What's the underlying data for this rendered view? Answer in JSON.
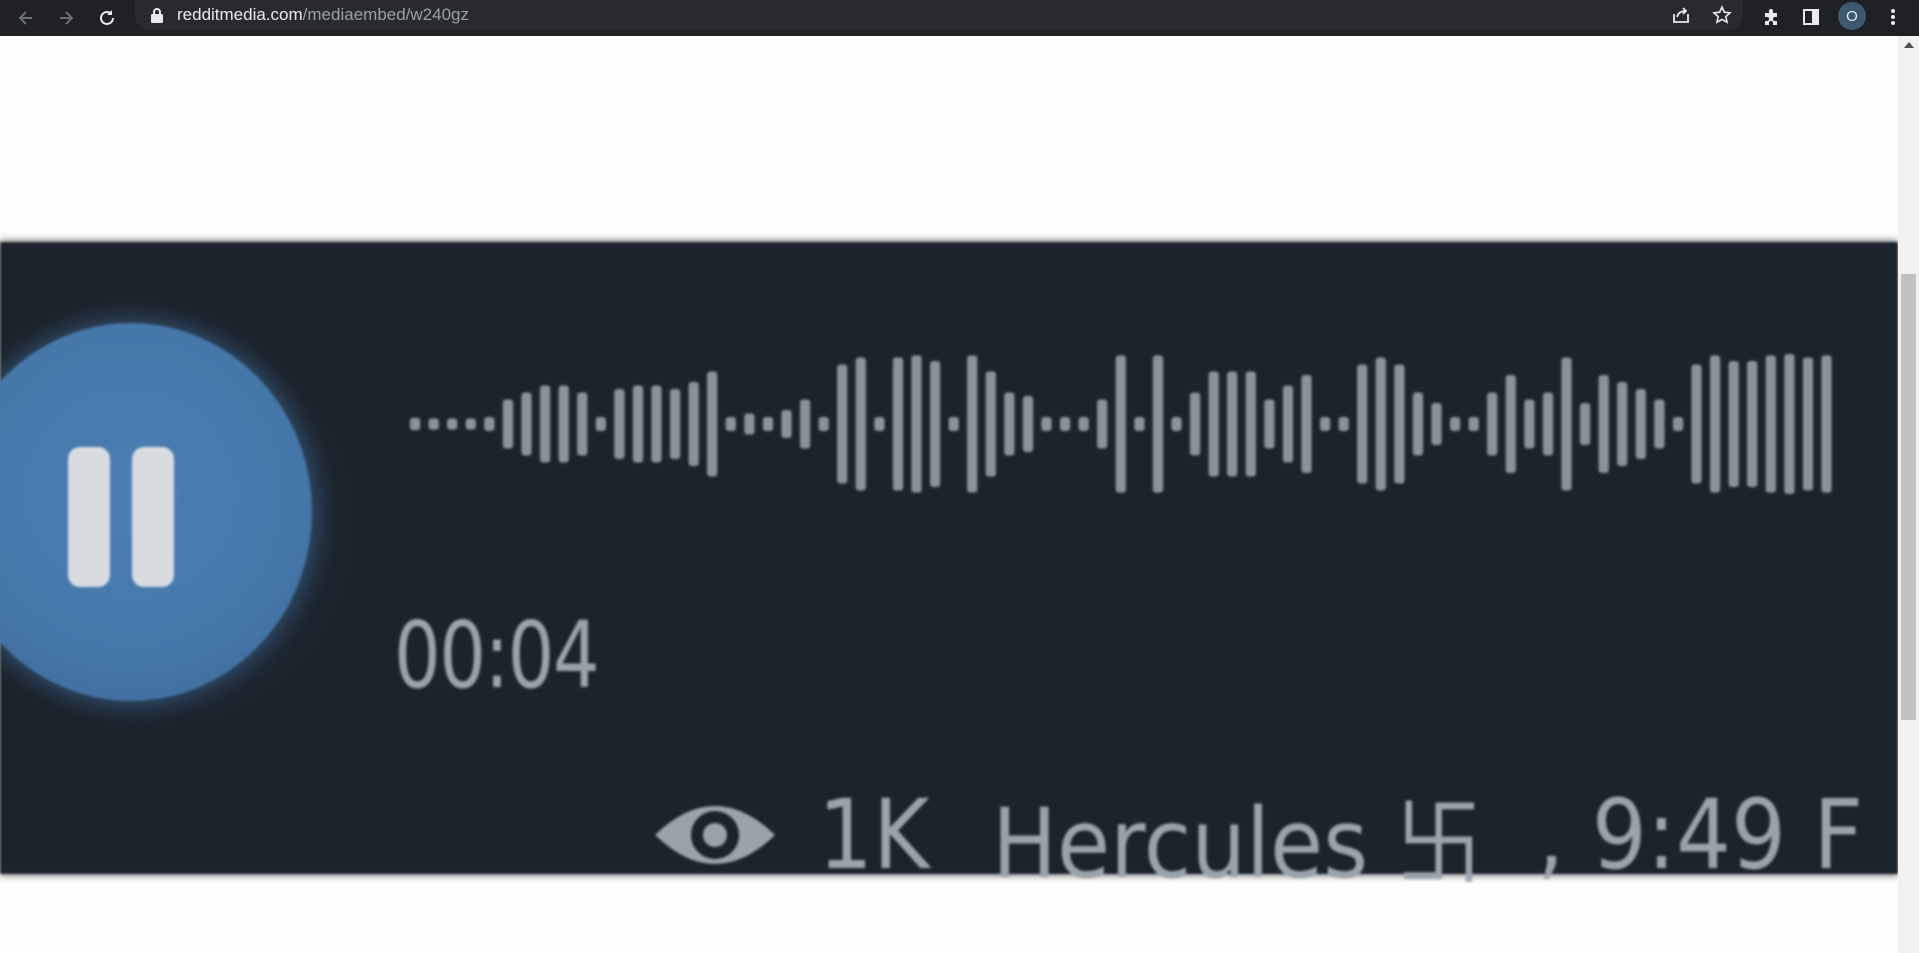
{
  "browser": {
    "url_host": "redditmedia.com",
    "url_path": "/mediaembed/w240gz",
    "profile_initial": "O",
    "icons": [
      "back-icon",
      "forward-icon",
      "reload-icon",
      "lock-icon",
      "share-icon",
      "star-icon",
      "extensions-icon",
      "side-panel-icon",
      "menu-icon"
    ]
  },
  "player": {
    "state": "playing",
    "elapsed_time": "00:04",
    "views": "1K",
    "author": "Hercules 卐",
    "timestamp_partial": ", 9:49 F",
    "colors": {
      "background": "#1c232b",
      "button": "#4577a9",
      "waveform": "#8a939b",
      "text": "#9aa3ab"
    }
  }
}
